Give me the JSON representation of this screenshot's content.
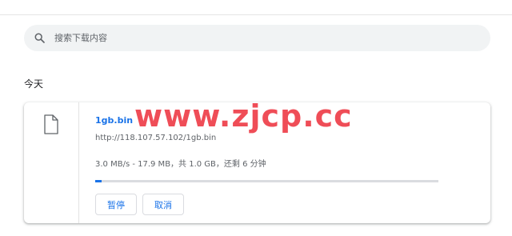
{
  "search": {
    "placeholder": "搜索下载内容"
  },
  "section": {
    "date_label": "今天"
  },
  "download": {
    "file_name": "1gb.bin",
    "url": "http://118.107.57.102/1gb.bin",
    "status": "3.0 MB/s - 17.9 MB，共 1.0 GB，还剩 6 分钟",
    "progress_fraction": 0.0175,
    "buttons": {
      "pause": "暂停",
      "cancel": "取消"
    }
  },
  "watermark": {
    "text": "www.zjcp.cc"
  },
  "colors": {
    "accent": "#1a73e8",
    "watermark": "#ef4d57",
    "search_bg": "#f1f3f4"
  },
  "icons": {
    "search": "search-icon",
    "file": "file-icon"
  }
}
